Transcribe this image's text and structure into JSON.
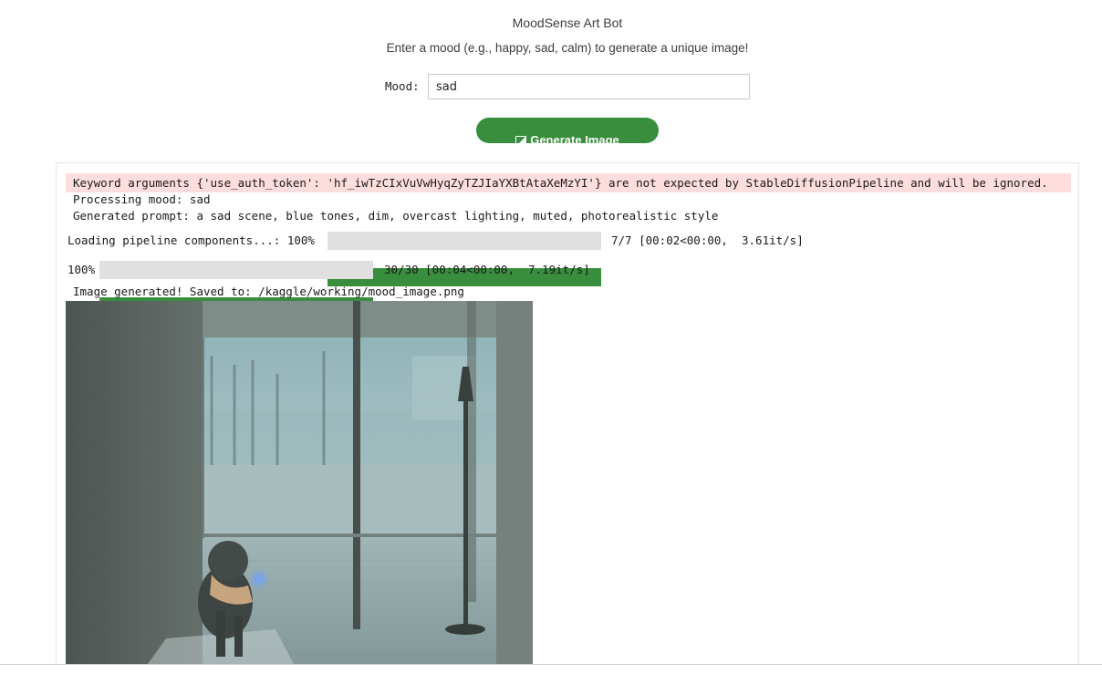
{
  "app": {
    "title": "MoodSense Art Bot",
    "subtitle": "Enter a mood (e.g., happy, sad, calm) to generate a unique image!"
  },
  "form": {
    "mood_label": "Mood:",
    "mood_value": "sad",
    "button_label": "Generate Image",
    "button_icon": "image-icon",
    "button_color": "#388e3c"
  },
  "output": {
    "warning": "Keyword arguments {'use_auth_token': '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'} are not expected by StableDiffusionPipeline and will be ignored.",
    "processing": "Processing mood: sad",
    "prompt": "Generated prompt: a sad scene, blue tones, dim, overcast lighting, muted, photorealistic style",
    "progress": [
      {
        "label": "Loading pipeline components...: 100%",
        "fraction": 1.0,
        "stats": "7/7 [00:02<00:00,  3.61it/s]"
      },
      {
        "label": "100%",
        "fraction": 1.0,
        "stats": "30/30 [00:04<00:00,  7.19it/s]"
      }
    ],
    "saved": "Image generated! Saved to: /kaggle/working/mood_image.png",
    "warning_bg": "#fddddd",
    "progress_color": "#388e3c"
  }
}
